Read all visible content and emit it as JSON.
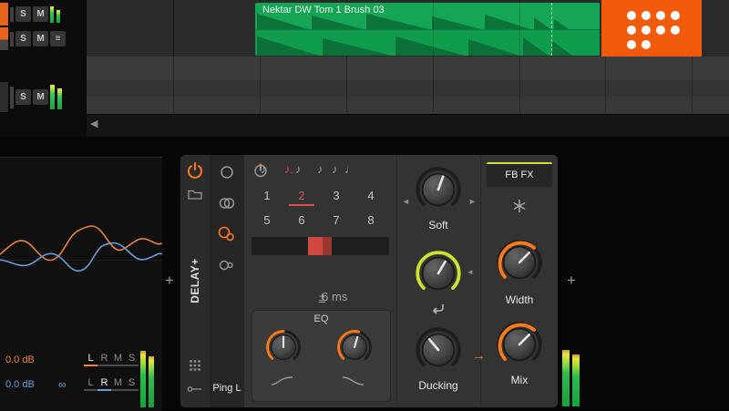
{
  "arranger": {
    "clip_name": "Nektar DW Tom 1 Brush 03",
    "solo_label": "S",
    "mute_label": "M"
  },
  "icons": {
    "menu": "≡",
    "scroll_left": "◀",
    "plus": "+",
    "arrow_left": "◄",
    "arrow_right": "►",
    "flow_arrow": "→",
    "infinity": "∞",
    "dotted_eighth_note": "♪.",
    "eighth_note": "♪",
    "quarter_note": "♩",
    "tick_note": "♪"
  },
  "device": {
    "title": "DELAY+",
    "preset_name": "Ping L",
    "grid_numbers": [
      "1",
      "2",
      "3",
      "4",
      "5",
      "6",
      "7",
      "8"
    ],
    "selected_number": "2",
    "time_offset_sign": "±",
    "time_offset_value": "6 ms",
    "eq_label": "EQ",
    "soft_label": "Soft",
    "ducking_label": "Ducking",
    "fbfx_label": "FB FX",
    "width_label": "Width",
    "mix_label": "Mix"
  },
  "scope": {
    "ch1_db": "0.0 dB",
    "ch2_db": "0.0 dB",
    "channels": [
      "L",
      "R",
      "M",
      "S"
    ]
  },
  "colors": {
    "accent_orange": "#ff7a1a",
    "clip_green": "#14a654",
    "value_red": "#e05252",
    "ring_green": "#cde32f",
    "meter_green": "#2dbb4e",
    "waveform_orange": "#e8823c",
    "waveform_blue": "#6b9bd8"
  }
}
